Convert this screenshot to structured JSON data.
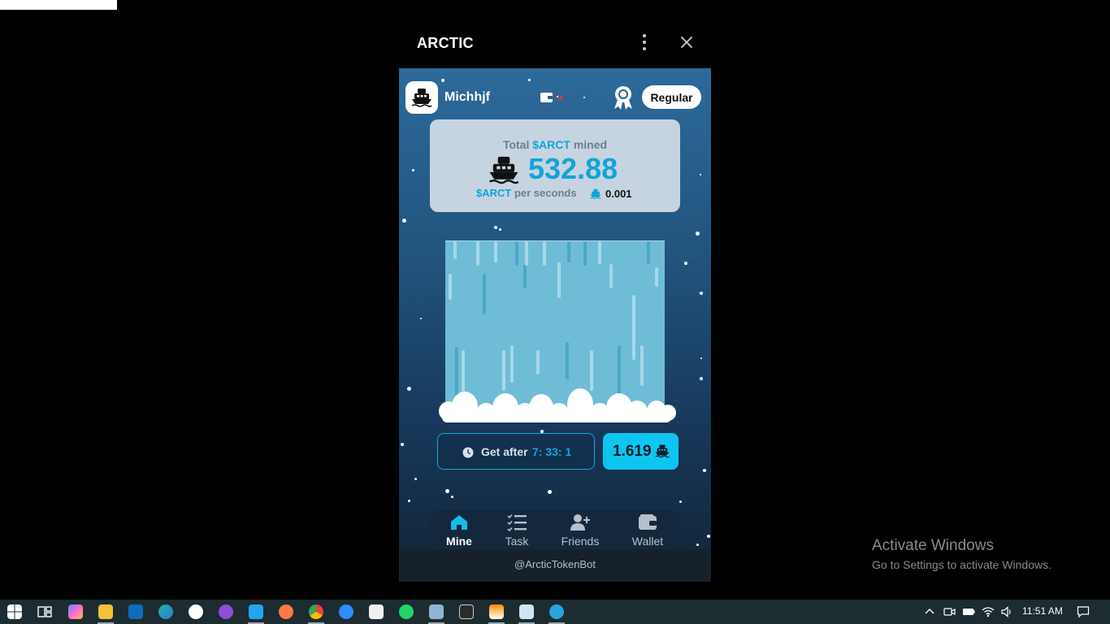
{
  "window": {
    "title": "ARCTIC",
    "menu_icon": "more-vertical-icon",
    "close_icon": "close-icon"
  },
  "header": {
    "avatar_icon": "ship-icon",
    "username": "Michhjf",
    "wallet_icon": "wallet-disconnected-icon",
    "award_icon": "award-icon",
    "rank": "Regular"
  },
  "stats": {
    "total_prefix": "Total",
    "token": "$ARCT",
    "total_suffix": "mined",
    "total_value": "532.88",
    "rate_token": "$ARCT",
    "rate_suffix": "per seconds",
    "rate_value": "0.001"
  },
  "mining": {
    "timer_label": "Get after",
    "timer_value": "7: 33: 1",
    "claim_value": "1.619"
  },
  "nav": {
    "items": [
      {
        "label": "Mine",
        "icon": "home-icon",
        "active": true
      },
      {
        "label": "Task",
        "icon": "checklist-icon",
        "active": false
      },
      {
        "label": "Friends",
        "icon": "add-friend-icon",
        "active": false
      },
      {
        "label": "Wallet",
        "icon": "wallet-icon",
        "active": false
      }
    ]
  },
  "footer": {
    "bot_handle": "@ArcticTokenBot"
  },
  "watermark": {
    "title": "Activate Windows",
    "subtitle": "Go to Settings to activate Windows."
  },
  "taskbar": {
    "time": "11:51 AM",
    "apps": [
      "start-icon",
      "task-view-icon",
      "copilot-icon",
      "file-explorer-icon",
      "outlook-icon",
      "edge-icon",
      "app-icon",
      "github-desktop-icon",
      "vscode-icon",
      "app-icon",
      "chrome-icon",
      "zoom-icon",
      "store-icon",
      "whatsapp-icon",
      "remote-desktop-icon",
      "terminal-icon",
      "vlc-icon",
      "notepad-icon",
      "telegram-icon"
    ]
  },
  "colors": {
    "accent": "#11a5da",
    "claim_button": "#0ec5ef",
    "card_bg": "#c6d4e1",
    "nav_bg": "#14283d"
  }
}
